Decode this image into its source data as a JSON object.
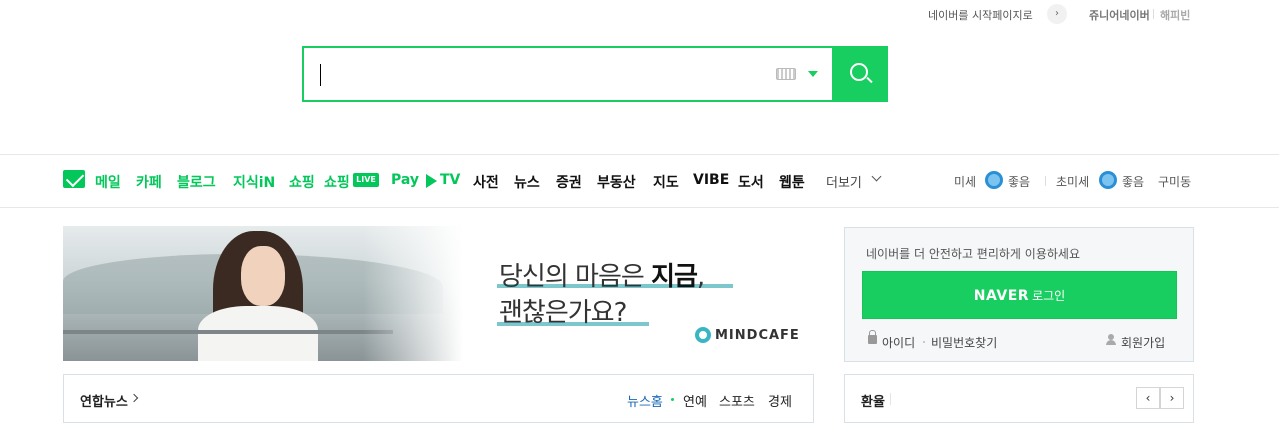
{
  "top_links": {
    "set_start_page": "네이버를 시작페이지로",
    "set_start_arrow": "›",
    "junior_naver": "쥬니어네이버",
    "happybean": "해피빈"
  },
  "search": {
    "value": "",
    "placeholder": ""
  },
  "nav": {
    "items": [
      {
        "label": "메일",
        "style": "green"
      },
      {
        "label": "카페",
        "style": "green"
      },
      {
        "label": "블로그",
        "style": "green"
      },
      {
        "label": "지식iN",
        "style": "green"
      },
      {
        "label": "쇼핑",
        "style": "green"
      },
      {
        "label": "쇼핑",
        "style": "green",
        "badge": "LIVE"
      },
      {
        "label": "Pay",
        "style": "green"
      },
      {
        "label": "TV",
        "style": "green"
      },
      {
        "label": "사전",
        "style": "black"
      },
      {
        "label": "뉴스",
        "style": "black"
      },
      {
        "label": "증권",
        "style": "black"
      },
      {
        "label": "부동산",
        "style": "black"
      },
      {
        "label": "지도",
        "style": "black"
      },
      {
        "label": "VIBE",
        "style": "black"
      },
      {
        "label": "도서",
        "style": "black"
      },
      {
        "label": "웹툰",
        "style": "black"
      }
    ],
    "more_label": "더보기"
  },
  "weather": {
    "fine_dust_label": "미세",
    "fine_dust_value": "좋음",
    "ultrafine_dust_label": "초미세",
    "ultrafine_dust_value": "좋음",
    "location": "구미동"
  },
  "banner": {
    "line1_prefix": "당신의 마음은 ",
    "line1_bold": "지금",
    "line1_suffix": ",",
    "line2": "괜찮은가요?",
    "brand": "MINDCAFE"
  },
  "login": {
    "message": "네이버를 더 안전하고 편리하게 이용하세요",
    "button_brand": "NAVER",
    "button_label": "로그인",
    "id_link": "아이디",
    "password_link": "비밀번호찾기",
    "signup_link": "회원가입"
  },
  "news": {
    "title": "연합뉴스",
    "tabs": [
      "뉴스홈",
      "연예",
      "스포츠",
      "경제"
    ],
    "active_tab": 0
  },
  "exchange": {
    "title": "환율",
    "prev": "‹",
    "next": "›"
  },
  "colors": {
    "brand_green": "#03c75a",
    "search_green": "#19ce60",
    "active_tab_blue": "#1a69b7"
  }
}
